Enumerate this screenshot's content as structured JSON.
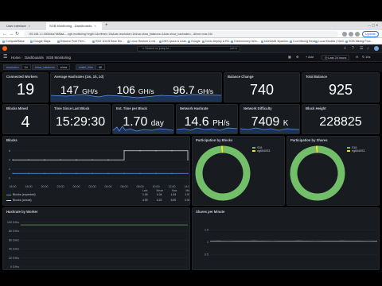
{
  "browser": {
    "tabs": [
      {
        "title": "User interface"
      },
      {
        "title": "SGB Monitoring - Dashboards"
      }
    ],
    "url": "192.168.1.1:3000/d/a7d6f3aa-...-sgb-monitoring?orgId=1&refresh=10s&var-resolution=1h&var-show_balances=1&var-show_hashrates=...&from=now-24h",
    "update_label": "Update",
    "bookmarks": [
      "ComputeRaise",
      "Google Maps",
      "Resolve Free Firm...",
      "RG2 1DGS Bear Din...",
      "Linux Restore a virt...",
      "DNS Quick & Lean...",
      "Google",
      "Dodo Deploy & Re...",
      "Greenmoney Item...",
      "tukin0481 klyanion...",
      "Cool Mining Rece...",
      "Local Models | Nem...",
      "SGB Mining Pool..."
    ]
  },
  "grafana": {
    "search_placeholder": "Search or jump to...",
    "search_shortcut": "ctrl+k",
    "breadcrumb": [
      "Home",
      "Dashboards",
      "SGB Monitoring"
    ],
    "toolbar": {
      "add_label": "Add",
      "time_range": "Last 24 hours",
      "refresh_label": "10s"
    },
    "variables": [
      {
        "label": "resolution",
        "value": "1h"
      },
      {
        "label": "show_balances",
        "value": "show"
      },
      {
        "label": "wallet_filter",
        "value": "All"
      }
    ]
  },
  "panels": {
    "connected_workers": {
      "title": "Connected Workers",
      "value": "19"
    },
    "avg_hashrates": {
      "title": "Average Hashrates (1m, 1h, 1d)",
      "values": [
        {
          "num": "147",
          "unit": "GH/s"
        },
        {
          "num": "106",
          "unit": "GH/s"
        },
        {
          "num": "96.7",
          "unit": "GH/s"
        }
      ]
    },
    "balance_change": {
      "title": "Balance Change",
      "value": "740"
    },
    "total_balance": {
      "title": "Total Balance",
      "value": "925"
    },
    "blocks_mined": {
      "title": "Blocks Mined",
      "value": "4"
    },
    "time_since_last": {
      "title": "Time Since Last Block",
      "value": "15:29:30"
    },
    "est_time": {
      "title": "Est. Time per Block",
      "num": "1.70",
      "unit": "day"
    },
    "network_hashrate": {
      "title": "Network Hashrate",
      "num": "14.6",
      "unit": "PH/s"
    },
    "network_difficulty": {
      "title": "Network Difficulty",
      "num": "7409",
      "unit": "K"
    },
    "block_height": {
      "title": "Block Height",
      "value": "228825"
    },
    "blocks_chart": {
      "title": "Blocks"
    },
    "participation_blocks": {
      "title": "Participation by Blocks"
    },
    "participation_shares": {
      "title": "Participation by Shares"
    },
    "hashrate_worker": {
      "title": "Hashrate by Worker"
    },
    "shares_per_minute": {
      "title": "Shares per Minute"
    }
  },
  "blocks_legend": {
    "headers": [
      "Last",
      "Mean",
      "Max",
      "Min"
    ],
    "rows": [
      {
        "name": "Blocks (expected)",
        "values": [
          "1.04",
          "1.04",
          "1.04",
          "1.04"
        ]
      },
      {
        "name": "Blocks (actual)",
        "values": [
          "4.00",
          "4.22",
          "6.00",
          "0.00"
        ]
      }
    ]
  },
  "donut_legend": [
    "S16",
    "rig6540S3"
  ],
  "colors": {
    "green": "#73bf69",
    "blue": "#5794f2",
    "yellow": "#fade2a",
    "bg": "#111217",
    "panel": "#181b1f"
  },
  "chart_data": [
    {
      "type": "line",
      "title": "Blocks",
      "x": [
        "16:00",
        "18:00",
        "20:00",
        "22:00",
        "00:00",
        "02:00",
        "04:00",
        "06:00",
        "08:00",
        "10:00",
        "12:00",
        "14:00"
      ],
      "yticks": [
        "6",
        "4",
        "2",
        "0"
      ],
      "ylim": [
        -1,
        7
      ],
      "series": [
        {
          "name": "Blocks (expected)",
          "color": "#5794f2",
          "values": [
            1.04,
            1.04,
            1.04,
            1.04,
            1.04,
            1.04,
            1.04,
            1.04,
            1.04,
            1.04,
            1.04,
            1.04
          ]
        },
        {
          "name": "Blocks (actual)",
          "color": "#e0e0e0",
          "values": [
            4,
            4,
            4,
            4,
            4,
            4,
            4,
            6,
            6,
            6,
            6,
            4
          ]
        }
      ]
    },
    {
      "type": "pie",
      "title": "Participation by Blocks",
      "categories": [
        "S16",
        "rig6540S3"
      ],
      "values": [
        99,
        1
      ]
    },
    {
      "type": "pie",
      "title": "Participation by Shares",
      "categories": [
        "S16",
        "rig6540S3"
      ],
      "values": [
        99,
        1
      ]
    },
    {
      "type": "line",
      "title": "Hashrate by Worker",
      "yticks": [
        "100 GH/s",
        "80 GH/s",
        "60 GH/s",
        "40 GH/s",
        "20 GH/s",
        "0 GH/s"
      ],
      "ylim": [
        0,
        110
      ],
      "series": [
        {
          "name": "S16",
          "values": [
            94,
            94,
            94,
            94,
            94,
            94,
            94,
            94,
            94,
            94,
            94,
            94,
            94,
            94,
            94,
            94,
            94,
            94,
            94,
            94
          ]
        }
      ]
    },
    {
      "type": "line",
      "title": "Shares per Minute",
      "yticks": [
        "1.5",
        "1",
        "0.5"
      ],
      "ylim": [
        0,
        2
      ],
      "series": [
        {
          "name": "shares",
          "values": [
            1.05,
            1.06,
            1.04,
            1.05,
            1.05,
            1.06,
            1.05,
            1.04,
            1.05,
            1.05,
            1.06,
            1.05,
            1.04,
            1.05,
            1.05,
            1.06,
            1.05,
            1.05,
            1.04,
            1.05
          ]
        }
      ]
    }
  ]
}
